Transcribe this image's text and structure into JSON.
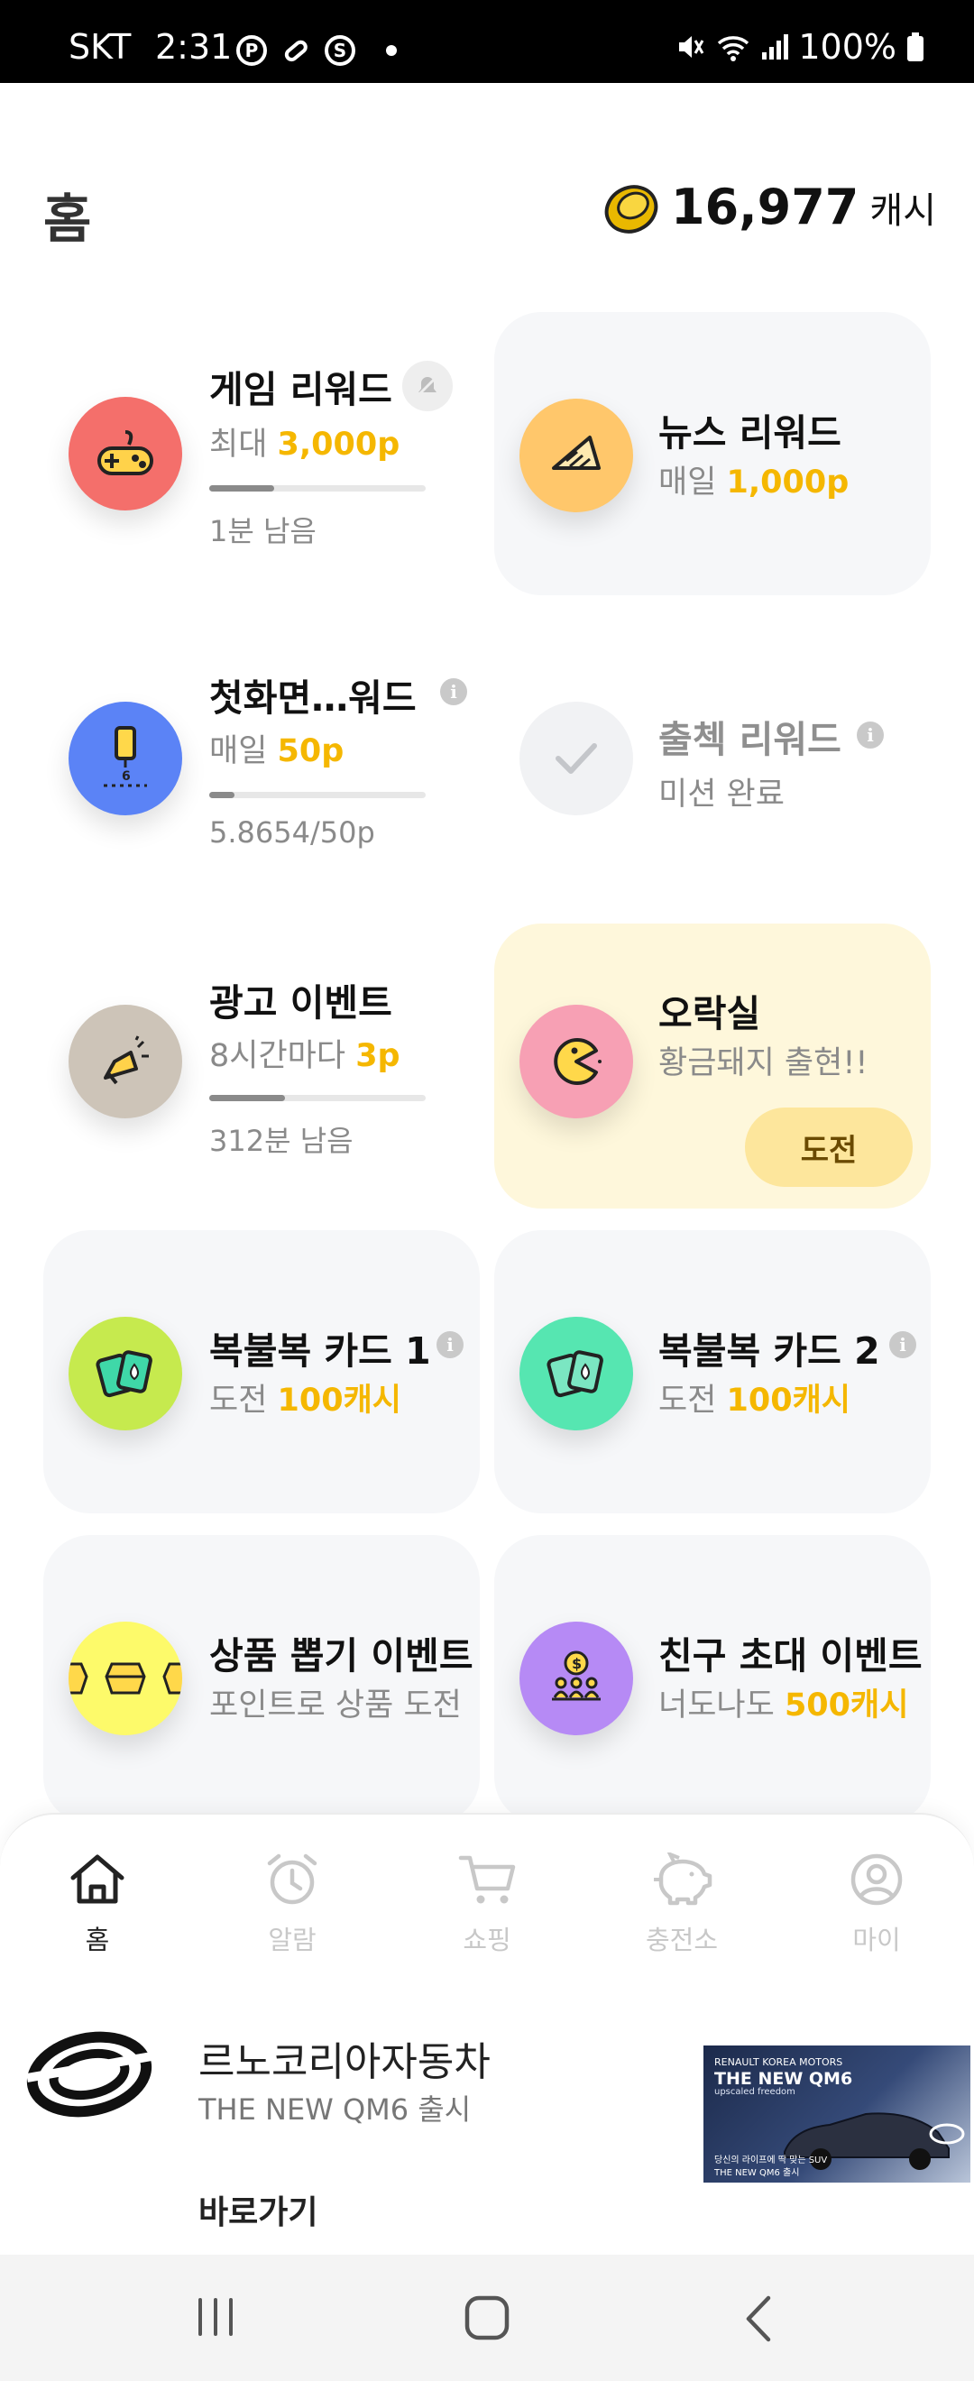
{
  "status_bar": {
    "carrier": "SKT",
    "time": "2:31",
    "battery": "100%",
    "icons": [
      "p-circle-icon",
      "pill-icon",
      "s-circle-icon",
      "dot-icon",
      "mute-icon",
      "wifi-icon",
      "signal-icon",
      "battery-icon"
    ]
  },
  "header": {
    "title": "홈",
    "cash_amount": "16,977",
    "cash_unit": "캐시"
  },
  "cards": {
    "game": {
      "title": "게임 리워드",
      "sub_prefix": "최대 ",
      "sub_value": "3,000p",
      "note": "1분 남음",
      "progress": 0.3
    },
    "news": {
      "title": "뉴스 리워드",
      "sub_prefix": "매일 ",
      "sub_value": "1,000p"
    },
    "first_screen": {
      "title": "첫화면…워드",
      "sub_prefix": "매일 ",
      "sub_value": "50p",
      "note": "5.8654/50p",
      "progress": 0.117
    },
    "attendance": {
      "title": "출첵 리워드",
      "sub": "미션 완료"
    },
    "ad_event": {
      "title": "광고 이벤트",
      "sub_prefix": "8시간마다 ",
      "sub_value": "3p",
      "note": "312분 남음",
      "progress": 0.35
    },
    "arcade": {
      "title": "오락실",
      "sub": "황금돼지 출현!!",
      "button": "도전"
    },
    "lucky1": {
      "title": "복불복 카드 1",
      "sub_prefix": "도전 ",
      "sub_value": "100캐시"
    },
    "lucky2": {
      "title": "복불복 카드 2",
      "sub_prefix": "도전 ",
      "sub_value": "100캐시"
    },
    "prize": {
      "title": "상품 뽑기 이벤트",
      "sub": "포인트로 상품 도전"
    },
    "invite": {
      "title": "친구 초대 이벤트",
      "sub_prefix": "너도나도 ",
      "sub_value": "500캐시"
    }
  },
  "nav": [
    {
      "label": "홈",
      "icon": "home-icon",
      "active": true
    },
    {
      "label": "알람",
      "icon": "alarm-icon",
      "active": false
    },
    {
      "label": "쇼핑",
      "icon": "cart-icon",
      "active": false
    },
    {
      "label": "충전소",
      "icon": "piggy-bank-icon",
      "active": false
    },
    {
      "label": "마이",
      "icon": "profile-icon",
      "active": false
    }
  ],
  "ad": {
    "advertiser": "르노코리아자동차",
    "subtitle": "THE NEW QM6 출시",
    "link": "바로가기",
    "image_text": {
      "brand": "RENAULT KOREA MOTORS",
      "model": "THE NEW QM6",
      "tagline": "upscaled freedom",
      "line1": "당신의 라이프에 딱 맞는 SUV",
      "line2": "THE NEW QM6 출시"
    }
  },
  "colors": {
    "highlight": "#f5b700",
    "card_gray": "#f6f7f9",
    "card_yellow": "#fef7db"
  }
}
